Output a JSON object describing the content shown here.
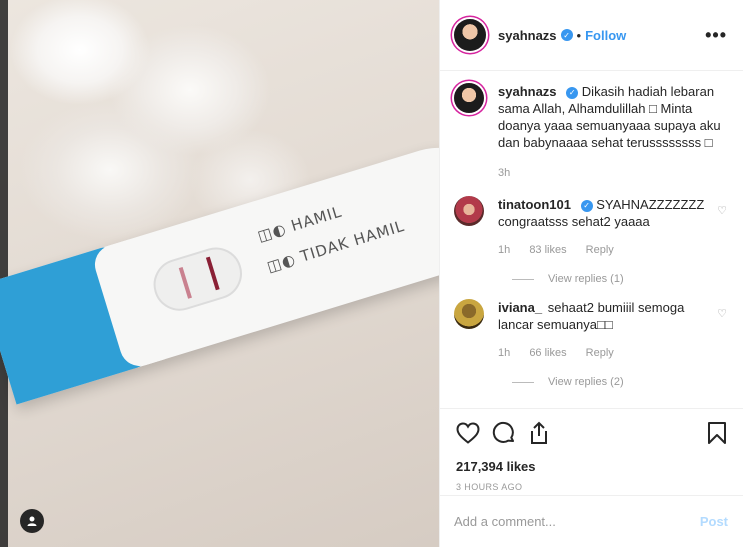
{
  "photo": {
    "test_text_1": "HAMIL",
    "test_text_2": "TIDAK HAMIL"
  },
  "header": {
    "username": "syahnazs",
    "separator": "•",
    "follow_label": "Follow",
    "more_label": "•••"
  },
  "caption": {
    "username": "syahnazs",
    "text": "Dikasih hadiah lebaran sama Allah, Alhamdulillah □ Minta doanya yaaa semuanyaaa supaya aku dan babynaaaa sehat terussssssss □",
    "time": "3h"
  },
  "comments": [
    {
      "username": "tinatoon101",
      "verified": true,
      "text": "SYAHNAZZZZZZZ congraatsss sehat2 yaaaa",
      "time": "1h",
      "likes": "83 likes",
      "reply_label": "Reply",
      "view_replies": "View replies (1)"
    },
    {
      "username": "iviana_",
      "verified": false,
      "text": "sehaat2 bumiiil semoga lancar semuanya□□",
      "time": "1h",
      "likes": "66 likes",
      "reply_label": "Reply",
      "view_replies": "View replies (2)"
    }
  ],
  "stats": {
    "likes": "217,394 likes",
    "time_ago": "3 HOURS AGO"
  },
  "add_comment": {
    "placeholder": "Add a comment...",
    "post_label": "Post"
  },
  "colors": {
    "accent": "#3897f0",
    "post_disabled": "#b3dbff"
  },
  "icons": [
    "heart-icon",
    "comment-icon",
    "share-icon",
    "bookmark-icon",
    "verified-icon",
    "more-icon",
    "user-tag-icon"
  ]
}
